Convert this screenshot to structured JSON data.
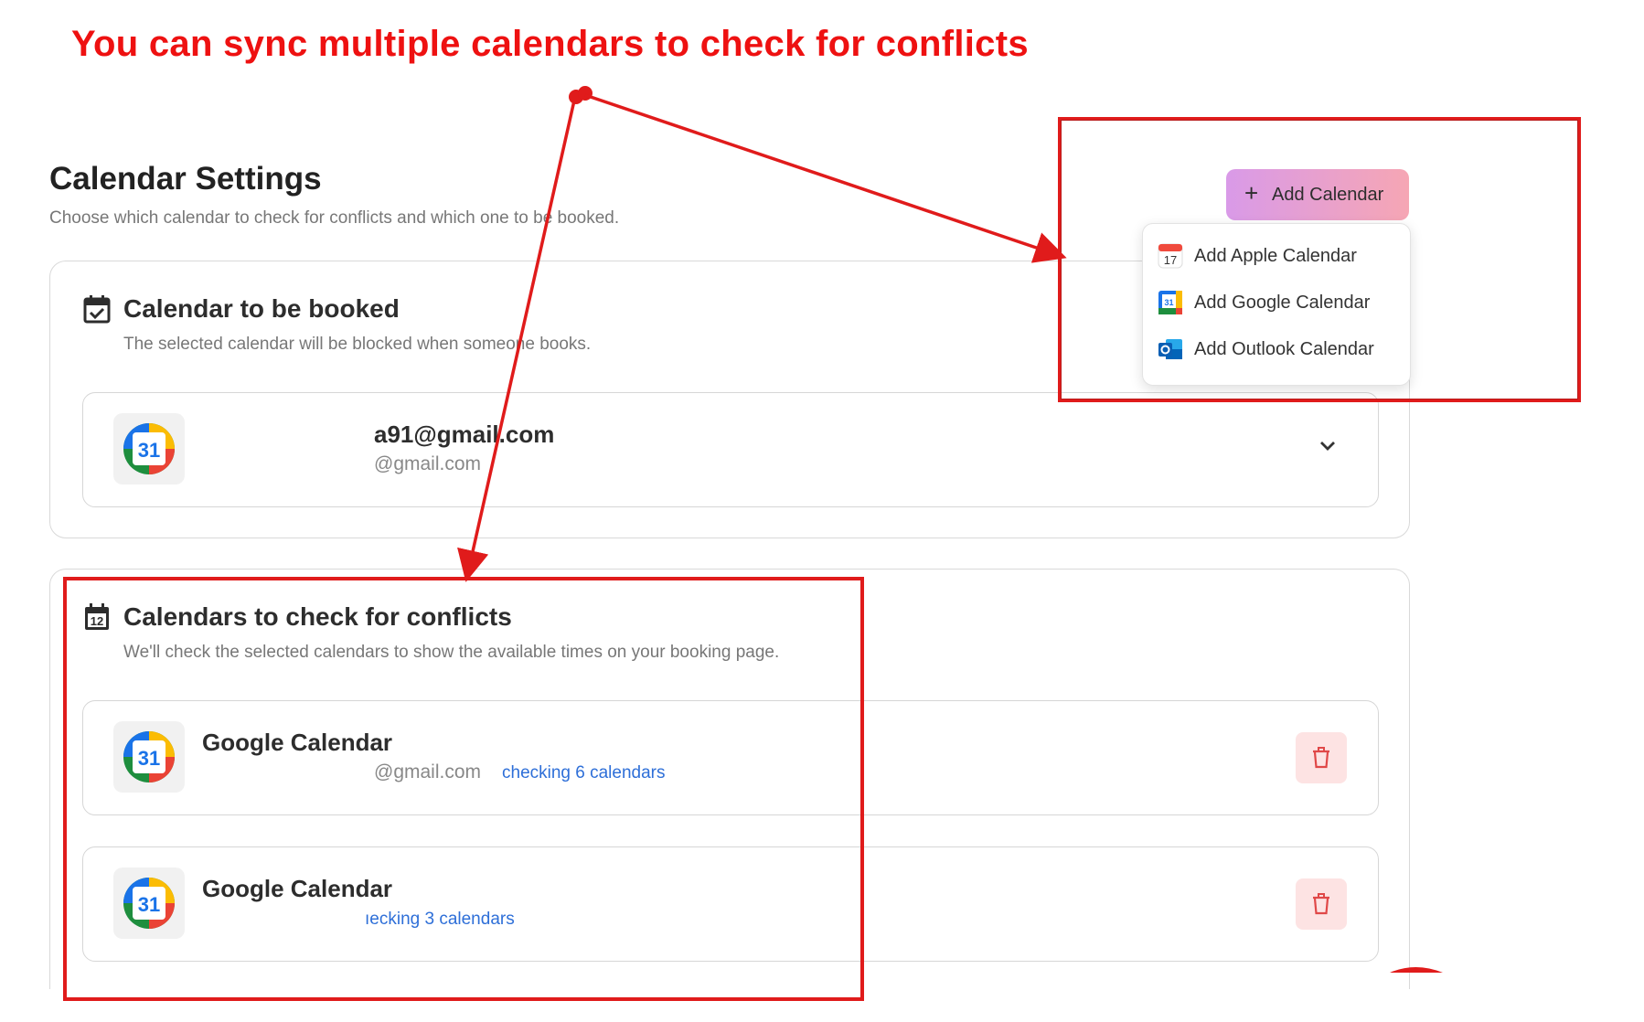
{
  "annotation": {
    "text": "You can sync multiple calendars to check for conflicts",
    "color": "#ee1111"
  },
  "page": {
    "title": "Calendar Settings",
    "subtitle": "Choose which calendar to check for conflicts and which one to be booked."
  },
  "add_calendar": {
    "label": "Add Calendar",
    "menu": [
      {
        "label": "Add Apple Calendar",
        "icon": "apple-calendar-icon"
      },
      {
        "label": "Add Google Calendar",
        "icon": "google-calendar-icon"
      },
      {
        "label": "Add Outlook Calendar",
        "icon": "outlook-calendar-icon"
      }
    ]
  },
  "booked": {
    "title": "Calendar to be booked",
    "description": "The selected calendar will be blocked when someone books.",
    "selected": {
      "email": "a91@gmail.com",
      "account": "@gmail.com",
      "icon": "google-calendar-icon"
    }
  },
  "conflicts": {
    "title": "Calendars to check for conflicts",
    "description": "We'll check the selected calendars to show the available times on your booking page.",
    "items": [
      {
        "title": "Google Calendar",
        "account": "@gmail.com",
        "status": "checking 6 calendars"
      },
      {
        "title": "Google Calendar",
        "account": "",
        "status": "ıecking 3 calendars"
      }
    ]
  },
  "colors": {
    "accent_link": "#2e6fd8",
    "annotation_red": "#e01b1b",
    "delete_bg": "#fde3e3"
  }
}
